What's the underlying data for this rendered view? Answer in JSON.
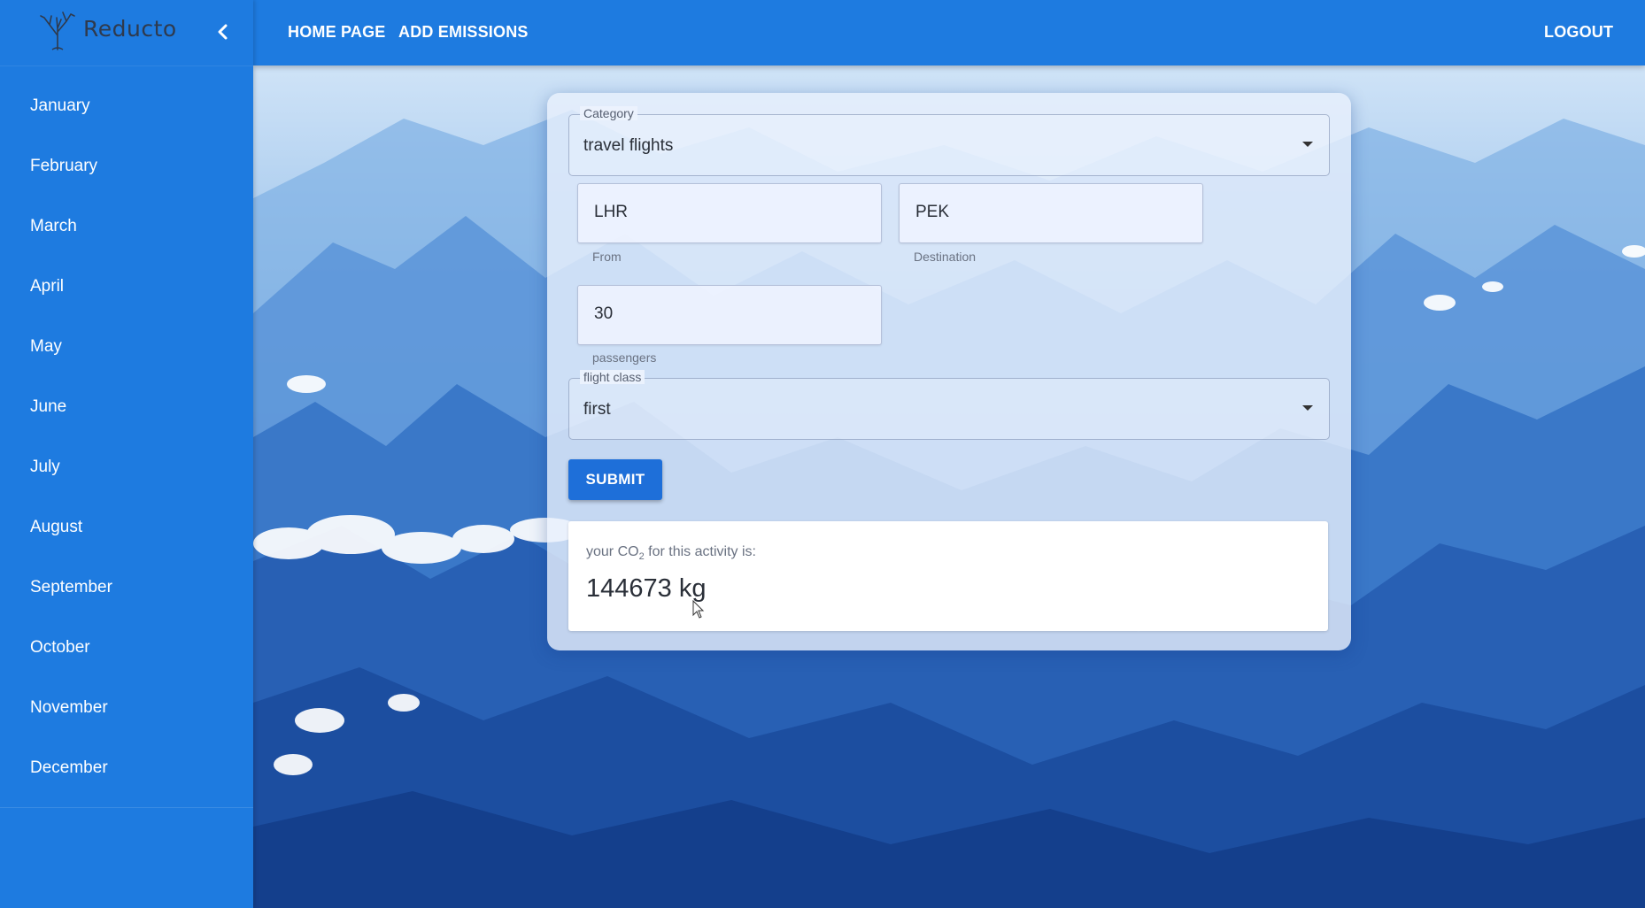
{
  "brand": {
    "name": "Reducto"
  },
  "nav": {
    "home": "HOME PAGE",
    "add_emissions": "ADD EMISSIONS",
    "logout": "LOGOUT"
  },
  "sidebar": {
    "months": [
      "January",
      "February",
      "March",
      "April",
      "May",
      "June",
      "July",
      "August",
      "September",
      "October",
      "November",
      "December"
    ]
  },
  "form": {
    "category": {
      "label": "Category",
      "value": "travel flights"
    },
    "from": {
      "value": "LHR",
      "helper": "From"
    },
    "destination": {
      "value": "PEK",
      "helper": "Destination"
    },
    "passengers": {
      "value": "30",
      "helper": "passengers"
    },
    "flight_class": {
      "label": "flight class",
      "value": "first"
    },
    "submit_label": "SUBMIT"
  },
  "result": {
    "caption_prefix": "your CO",
    "caption_sub": "2",
    "caption_suffix": " for this activity is:",
    "amount": "144673 kg"
  },
  "colors": {
    "primary": "#1e7be0",
    "button": "#1e6fd9",
    "sky": "#8fbbe8",
    "mountain": "#1a4fa8"
  }
}
